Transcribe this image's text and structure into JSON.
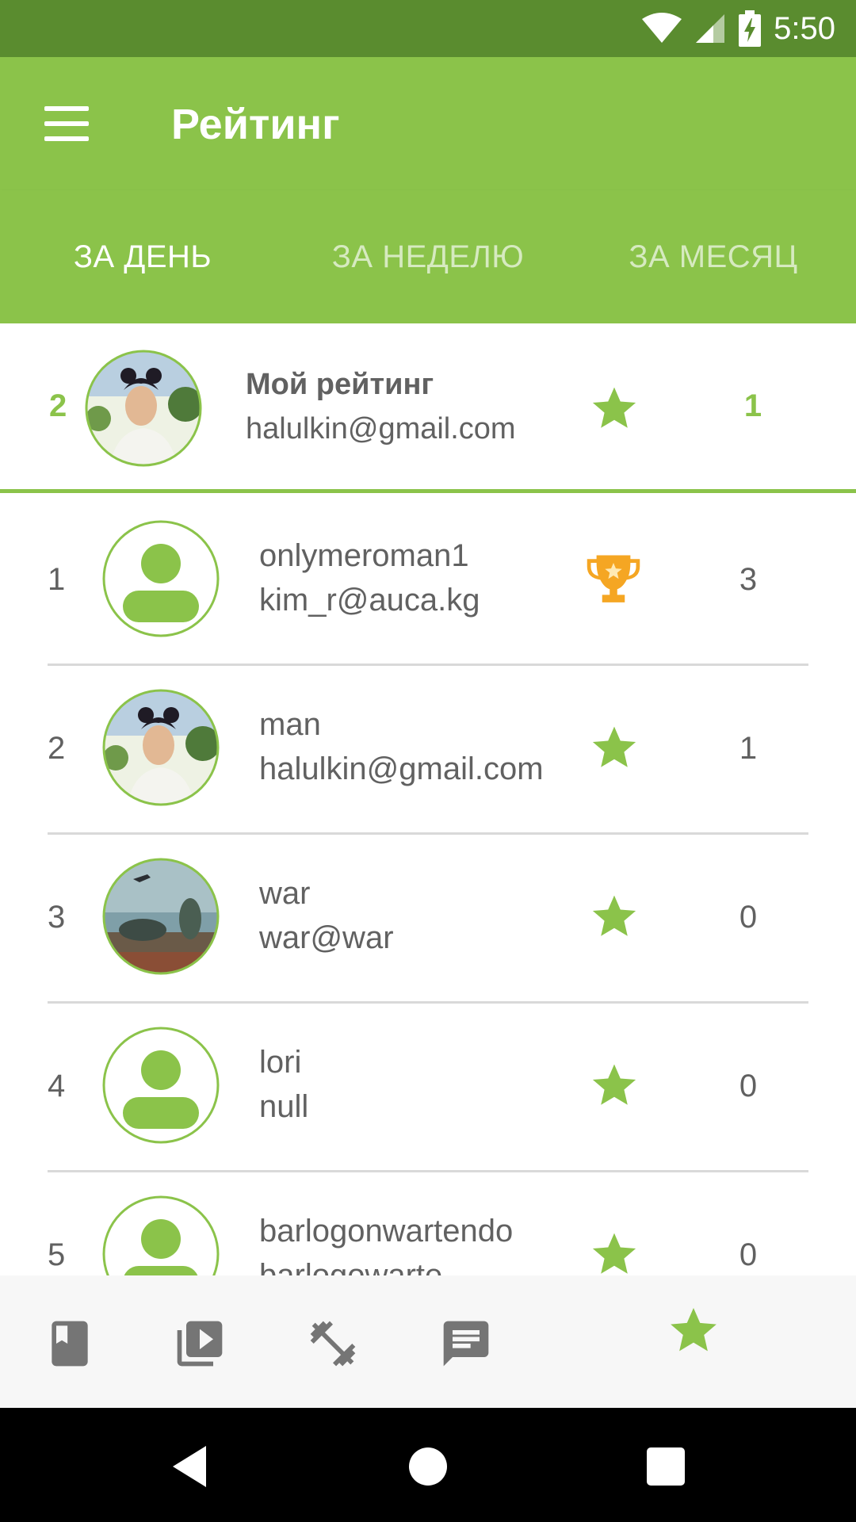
{
  "status_bar": {
    "time": "5:50",
    "icons": [
      "wifi-icon",
      "cell-signal-icon",
      "battery-charging-icon"
    ]
  },
  "app_bar": {
    "menu_icon": "menu-icon",
    "title": "Рейтинг"
  },
  "tabs": [
    {
      "label": "ЗА ДЕНЬ",
      "active": true
    },
    {
      "label": "ЗА НЕДЕЛЮ",
      "active": false
    },
    {
      "label": "ЗА МЕСЯЦ",
      "active": false
    }
  ],
  "my_rating": {
    "rank": "2",
    "name": "Мой рейтинг",
    "email": "halulkin@gmail.com",
    "avatar": "photo-avatar",
    "badge": "star-icon",
    "score": "1"
  },
  "leaderboard": [
    {
      "rank": "1",
      "name": "onlymeroman1",
      "email": "kim_r@auca.kg",
      "avatar": "default-avatar",
      "badge": "trophy-icon",
      "score": "3"
    },
    {
      "rank": "2",
      "name": "man",
      "email": "halulkin@gmail.com",
      "avatar": "photo-avatar",
      "badge": "star-icon",
      "score": "1"
    },
    {
      "rank": "3",
      "name": "war",
      "email": "war@war",
      "avatar": "landscape-avatar",
      "badge": "star-icon",
      "score": "0"
    },
    {
      "rank": "4",
      "name": "lori",
      "email": "null",
      "avatar": "default-avatar",
      "badge": "star-icon",
      "score": "0"
    },
    {
      "rank": "5",
      "name": "barlogonwartendo",
      "email": "barlogowarte",
      "avatar": "default-avatar",
      "badge": "star-icon",
      "score": "0"
    }
  ],
  "bottom_nav": [
    "book-icon",
    "video-library-icon",
    "fitness-icon",
    "chat-icon",
    "star-icon"
  ],
  "bottom_nav_active": "star-icon",
  "system_nav": [
    "back-icon",
    "home-icon",
    "recents-icon"
  ],
  "colors": {
    "primary": "#8bc34a",
    "primary_dark": "#5a8c2f",
    "text": "#616161",
    "nav_icon": "#757575",
    "trophy": "#f5a623"
  }
}
